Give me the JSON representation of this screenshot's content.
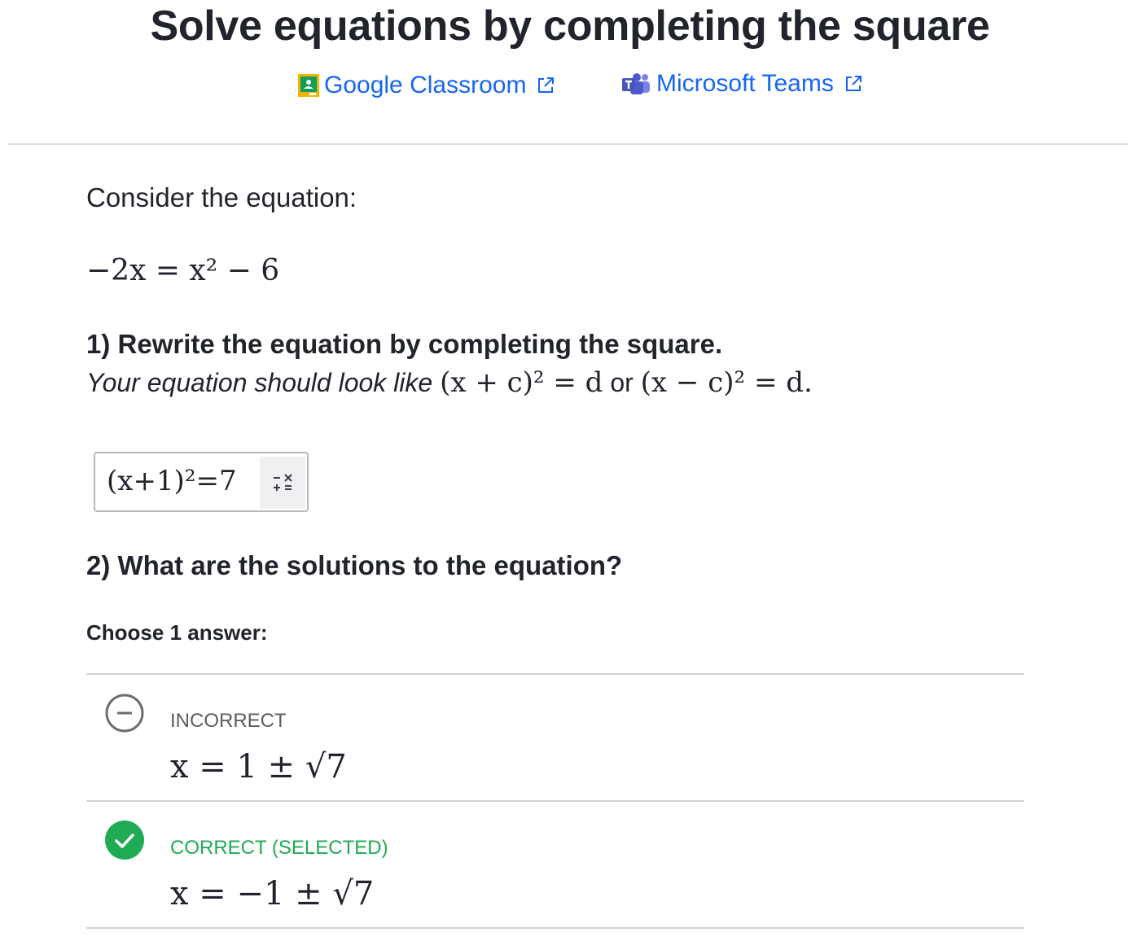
{
  "page": {
    "title": "Solve equations by completing the square"
  },
  "share": {
    "google_classroom": "Google Classroom",
    "microsoft_teams": "Microsoft Teams"
  },
  "problem": {
    "intro": "Consider the equation:",
    "equation": "−2x = x² − 6"
  },
  "question1": {
    "prompt": "1) Rewrite the equation by completing the square.",
    "hint_prefix": "Your equation should look like",
    "hint_or": "or",
    "hint_form_1": "(x + c)² = d",
    "hint_form_2": "(x − c)² = d",
    "answer_value": "(x+1)²=7",
    "keypad_icon": "math-keypad-icon"
  },
  "question2": {
    "prompt": "2) What are the solutions to the equation?",
    "instruction": "Choose 1 answer:",
    "choices": [
      {
        "status": "INCORRECT",
        "math": "x = 1 ± √7",
        "icon": "minus-circle-icon",
        "color": "#5b5d62"
      },
      {
        "status": "CORRECT (SELECTED)",
        "math": "x = −1 ± √7",
        "icon": "check-circle-icon",
        "color": "#1fab54"
      }
    ]
  },
  "colors": {
    "link": "#1865f2",
    "correct": "#1fab54",
    "text": "#21242c"
  }
}
